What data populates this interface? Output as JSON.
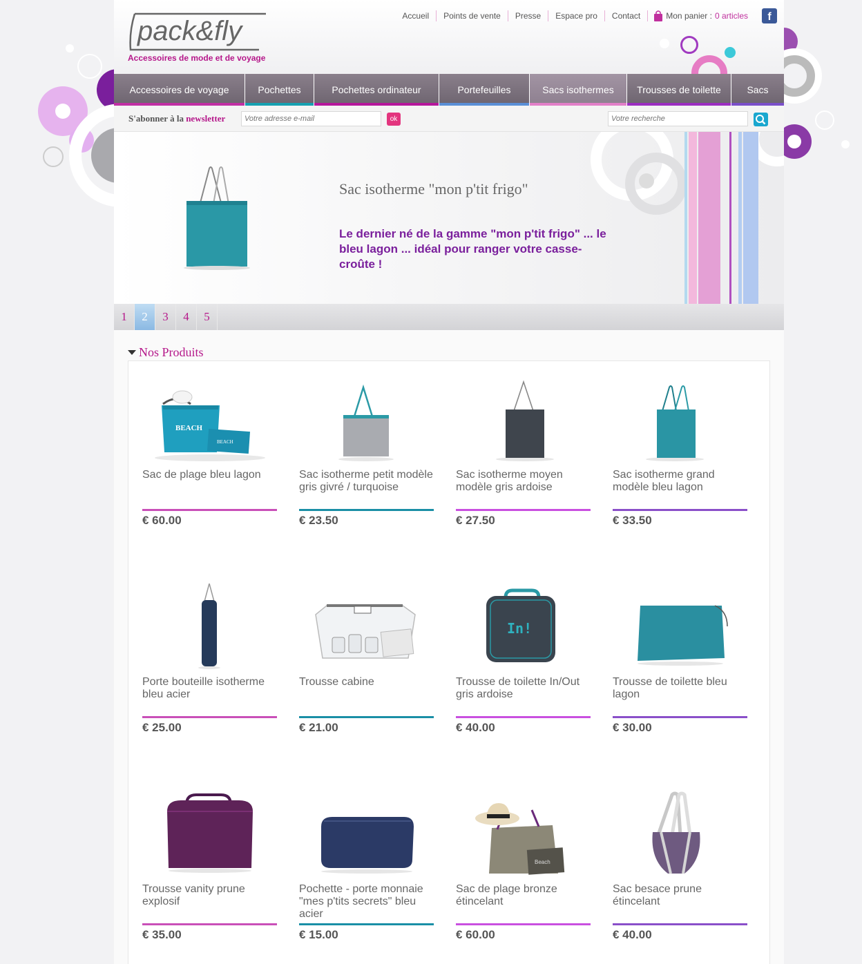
{
  "brand": {
    "logo_text": "pack&fly",
    "tagline": "Accessoires de mode et de voyage"
  },
  "topnav": {
    "items": [
      "Accueil",
      "Points de vente",
      "Presse",
      "Espace pro",
      "Contact"
    ],
    "cart_label": "Mon panier : ",
    "cart_count": "0 articles",
    "facebook_glyph": "f"
  },
  "categories": [
    {
      "label": "Accessoires de voyage",
      "color": "#c02fa3"
    },
    {
      "label": "Pochettes",
      "color": "#16a0b0"
    },
    {
      "label": "Pochettes ordinateur",
      "color": "#b5179b"
    },
    {
      "label": "Portefeuilles",
      "color": "#5a8fd6"
    },
    {
      "label": "Sacs isothermes",
      "color": "#e27fc8"
    },
    {
      "label": "Trousses de toilette",
      "color": "#9b2ec0"
    },
    {
      "label": "Sacs",
      "color": "#7a4fc9"
    }
  ],
  "newsletter": {
    "prefix": "S'abonner à la ",
    "highlight": "newsletter",
    "placeholder": "Votre adresse e-mail",
    "button": "ok"
  },
  "search": {
    "placeholder": "Votre recherche"
  },
  "slide": {
    "title": "Sac isotherme \"mon p'tit frigo\"",
    "text": "Le dernier né de la gamme \"mon p'tit frigo\" ... le bleu lagon ... idéal pour ranger votre casse-croûte !"
  },
  "pager": {
    "pages": [
      "1",
      "2",
      "3",
      "4",
      "5"
    ],
    "active": 2
  },
  "section": {
    "title": "Nos Produits"
  },
  "products": [
    {
      "name": "Sac de plage bleu lagon",
      "price": "€ 60.00",
      "line_color": "#c94fb8"
    },
    {
      "name": "Sac isotherme petit modèle gris givré / turquoise",
      "price": "€ 23.50",
      "line_color": "#1a8fa6"
    },
    {
      "name": "Sac isotherme moyen modèle gris ardoise",
      "price": "€ 27.50",
      "line_color": "#c94fe0"
    },
    {
      "name": "Sac isotherme grand modèle bleu lagon",
      "price": "€ 33.50",
      "line_color": "#8a4fc9"
    },
    {
      "name": "Porte bouteille isotherme bleu acier",
      "price": "€ 25.00",
      "line_color": "#c94fb8"
    },
    {
      "name": "Trousse cabine",
      "price": "€ 21.00",
      "line_color": "#1a8fa6"
    },
    {
      "name": "Trousse de toilette In/Out gris ardoise",
      "price": "€ 40.00",
      "line_color": "#c94fe0"
    },
    {
      "name": "Trousse de toilette bleu lagon",
      "price": "€ 30.00",
      "line_color": "#8a4fc9"
    },
    {
      "name": "Trousse vanity prune explosif",
      "price": "€ 35.00",
      "line_color": "#c94fb8"
    },
    {
      "name": "Pochette - porte monnaie \"mes p'tits secrets\" bleu acier",
      "price": "€ 15.00",
      "line_color": "#1a8fa6"
    },
    {
      "name": "Sac de plage bronze étincelant",
      "price": "€ 60.00",
      "line_color": "#c94fe0"
    },
    {
      "name": "Sac besace prune étincelant",
      "price": "€ 40.00",
      "line_color": "#8a4fc9"
    }
  ],
  "product_image_labels": {
    "beach": "BEACH",
    "inout": "In!",
    "beach_small": "Beach"
  }
}
